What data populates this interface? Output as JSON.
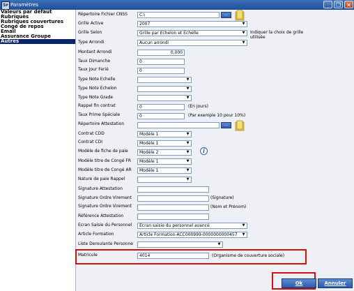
{
  "window": {
    "title": "Paramètres",
    "app_icon": "app-icon",
    "minimize": "_",
    "restore": "❐",
    "close": "✕"
  },
  "sidebar": {
    "items": [
      {
        "label": "Valeurs par défaut",
        "selected": false
      },
      {
        "label": "Rubriques",
        "selected": false
      },
      {
        "label": "Rubriques couvertures",
        "selected": false
      },
      {
        "label": "Congé de repos",
        "selected": false
      },
      {
        "label": "Email",
        "selected": false
      },
      {
        "label": "Assurance Groupe",
        "selected": false
      },
      {
        "label": "Autres",
        "selected": true
      }
    ]
  },
  "form": {
    "repertoire_cnss": {
      "label": "Répertoire Fichier CNSS",
      "value": "C:\\",
      "browse": "..."
    },
    "grille_active": {
      "label": "Grille Active",
      "value": "2007"
    },
    "grille_selon": {
      "label": "Grille Selon",
      "value": "Grille par Echelon et Echelle",
      "note": "Indiquer la choix de grille utilisée"
    },
    "type_arrondi": {
      "label": "Type Arrondi",
      "value": "Aucun arrondi"
    },
    "montant_arrondi": {
      "label": "Montant Arrondi",
      "value": "0,000"
    },
    "taux_dimanche": {
      "label": "Taux Dimanche",
      "value": "0"
    },
    "taux_jour_ferie": {
      "label": "Taux Jour Ferié",
      "value": "0"
    },
    "type_note_echelle": {
      "label": "Type Note Echelle",
      "value": ""
    },
    "type_note_echelon": {
      "label": "Type Note Echelon",
      "value": ""
    },
    "type_note_grade": {
      "label": "Type Note Grade",
      "value": ""
    },
    "rappel_fin_contrat": {
      "label": "Rappel fin contrat",
      "value": "0",
      "note": "(En jours)"
    },
    "taux_prime_speciale": {
      "label": "Taux Prime Spéciale",
      "value": "0",
      "note": "(Par exemple 10 pour 10%)"
    },
    "repertoire_attestation": {
      "label": "Répertoire Attestation",
      "value": "",
      "browse": "..."
    },
    "contrat_cdd": {
      "label": "Contrat CDD",
      "value": "Modèle 1"
    },
    "contrat_cdi": {
      "label": "Contrat CDI",
      "value": "Modèle 1"
    },
    "modele_fiche_paie": {
      "label": "Modèle de fiche de paie",
      "value": "Modèle 2"
    },
    "modele_titre_conge_fr": {
      "label": "Modèle titre de Congé FR",
      "value": "Modèle 1"
    },
    "modele_titre_conge_ar": {
      "label": "Modèle titre de Congé AR",
      "value": "Modèle 1"
    },
    "nature_paie_rappel": {
      "label": "Nature de paie Rappel",
      "value": ""
    },
    "signature_attestation": {
      "label": "Signature Attestation",
      "value": ""
    },
    "signature_ordre_virement_1": {
      "label": "Signature Ordre Virement",
      "value": "",
      "note": "(Signature)"
    },
    "signature_ordre_virement_2": {
      "label": "Signature Ordre Virement",
      "value": "",
      "note": "(Nom et Prénom)"
    },
    "reference_attestation": {
      "label": "Référence Attestation",
      "value": ""
    },
    "ecran_saisie_personnel": {
      "label": "Ecran Saisie du Personnel",
      "value": "Ecran saisie du personnel avancé"
    },
    "article_formation": {
      "label": "Article Formation",
      "value": "Article Formation-ACC000999-0000000000457"
    },
    "liste_deroulante_personne": {
      "label": "Liste Deroulante Personne",
      "value": ""
    },
    "matricule": {
      "label": "Matricule",
      "value": "4014",
      "note": "(Organisme de couverture sociale)"
    }
  },
  "buttons": {
    "ok": "Ok",
    "annuler": "Annuler"
  },
  "icons": {
    "folder": "folder-icon",
    "info": "info-icon",
    "info_glyph": "i",
    "arrow": "▼"
  },
  "colors": {
    "title_bar": "#2a5aa8",
    "selected_nav": "#0a246a",
    "highlight": "#d01010",
    "panel_bg": "#eef0f6"
  }
}
